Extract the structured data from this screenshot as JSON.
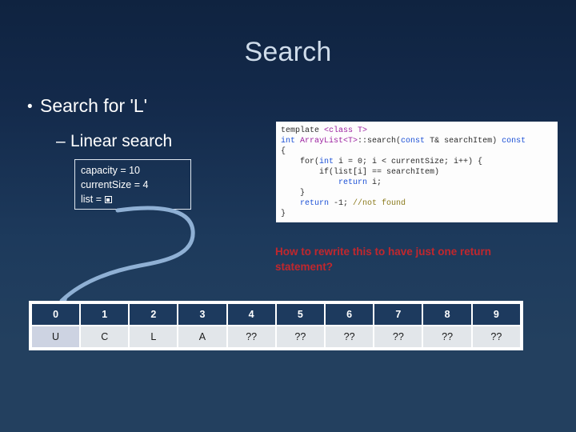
{
  "slide": {
    "title": "Search",
    "bullets": {
      "level1": "Search for 'L'",
      "level1_marker": "•",
      "level2": "Linear search",
      "level2_marker": "–"
    },
    "variable_box": {
      "line1": "capacity = 10",
      "line2": "currentSize = 4",
      "line3_label": "list = "
    },
    "code": {
      "line1_a": "template ",
      "line1_b": "<class T>",
      "line2_a": "int ",
      "line2_b": "ArrayList<T>",
      "line2_c": "::search(",
      "line2_d": "const",
      "line2_e": " T& searchItem) ",
      "line2_f": "const",
      "line3": "{",
      "line4_a": "    for(",
      "line4_b": "int",
      "line4_c": " i = 0; i < currentSize; i++) {",
      "line5": "        if(list[i] == searchItem)",
      "line6_a": "            ",
      "line6_b": "return",
      "line6_c": " i;",
      "line7": "    }",
      "line8_a": "    ",
      "line8_b": "return",
      "line8_c": " -1; ",
      "line8_d": "//not found",
      "line9": "}"
    },
    "question": "How to rewrite this to have just one return statement?",
    "array": {
      "indices": [
        "0",
        "1",
        "2",
        "3",
        "4",
        "5",
        "6",
        "7",
        "8",
        "9"
      ],
      "values": [
        "U",
        "C",
        "L",
        "A",
        "??",
        "??",
        "??",
        "??",
        "??",
        "??"
      ]
    },
    "colors": {
      "background_top": "#0f2340",
      "background_bottom": "#23405f",
      "title": "#cfdcea",
      "body_text": "#ffffff",
      "question_red": "#c1272d",
      "arrow": "#8fb0d4",
      "table_header": "#1d3a5e",
      "table_cell": "#e2e6ea",
      "table_cell_first": "#cdd3e2",
      "code_background": "#fdfdfd",
      "code_keyword": "#1a4fd6",
      "code_class": "#9b1fa0",
      "code_comment": "#8a7a1c"
    }
  }
}
